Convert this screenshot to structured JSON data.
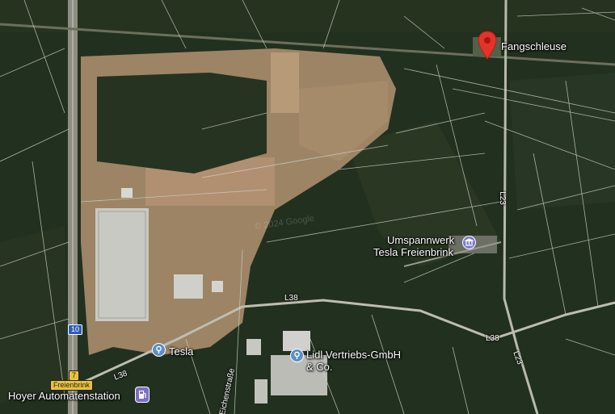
{
  "map": {
    "colors": {
      "forest": "#22301f",
      "forest_light": "#2e3d27",
      "cleared": "#a88a68",
      "road_lines": "#d6d6cf",
      "pin_red": "#e5332a",
      "poi_blue": "#5b8fc7",
      "poi_purple": "#7a6fc4"
    }
  },
  "places": {
    "fangschleuse": {
      "name": "Fangschleuse",
      "icon": "red-map-pin"
    },
    "umspannwerk": {
      "line1": "Umspannwerk",
      "line2": "Tesla Freienbrink",
      "icon": "landmark-icon"
    },
    "tesla": {
      "name": "Tesla",
      "icon": "location-pin-icon"
    },
    "lidl": {
      "line1": "Lidl Vertriebs-GmbH",
      "line2": "& Co.",
      "icon": "location-pin-icon"
    },
    "hoyer": {
      "name": "Hoyer Automatenstation",
      "icon": "fuel-pump-icon"
    }
  },
  "roads": {
    "l23_north": "L23",
    "l23_south": "L23",
    "l38_center": "L38",
    "l38_east": "L38",
    "l38_west": "L38",
    "street": "Eichenstraße"
  },
  "shields": {
    "a10": "10",
    "exit7": "7",
    "freienbrink": "Freienbrink"
  }
}
